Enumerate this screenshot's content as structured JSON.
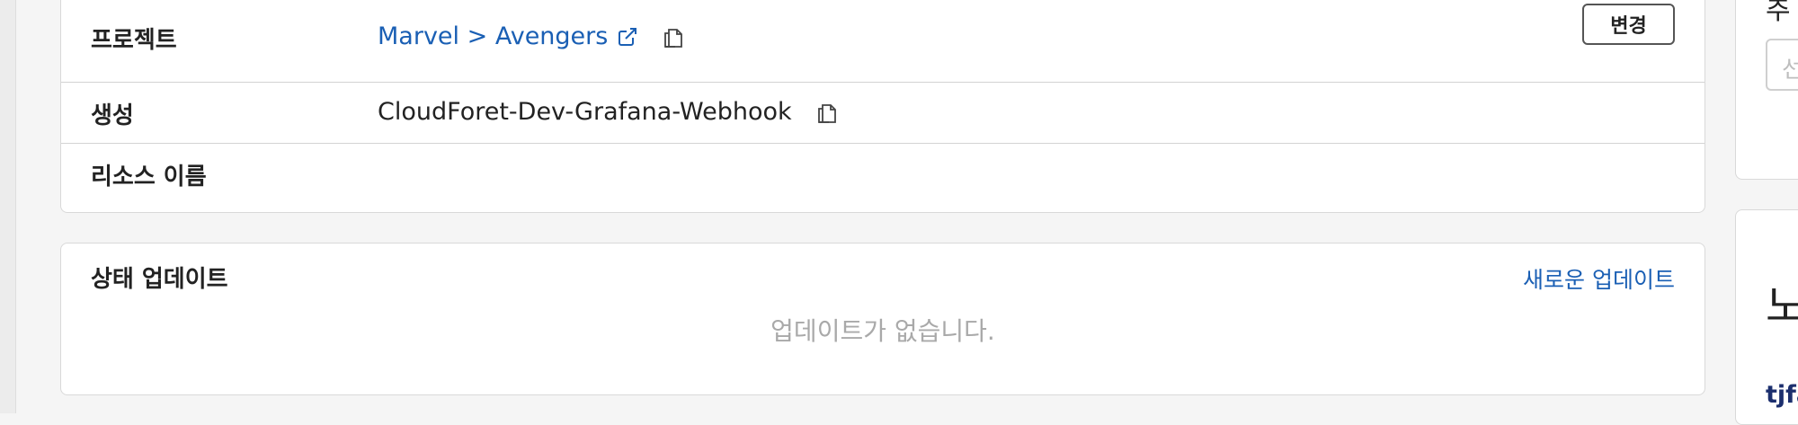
{
  "info": {
    "rows": [
      {
        "label": "프로젝트",
        "value": "Marvel > Avengers"
      },
      {
        "label": "생성",
        "value": "CloudForet-Dev-Grafana-Webhook"
      },
      {
        "label": "리소스 이름",
        "value": ""
      }
    ],
    "change_label": "변경"
  },
  "status": {
    "title": "상태 업데이트",
    "new_update_label": "새로운 업데이트",
    "empty_text": "업데이트가 없습니다."
  },
  "side": {
    "heading_partial": "추",
    "input_placeholder_partial": "선",
    "big_text_partial": "노",
    "user_partial": "tjfa"
  },
  "colors": {
    "link": "#1a5fb4",
    "background": "#f5f5f5",
    "muted_text": "#a9a9a9"
  },
  "icons": {
    "external_link": "external-link-icon",
    "copy": "copy-icon"
  }
}
